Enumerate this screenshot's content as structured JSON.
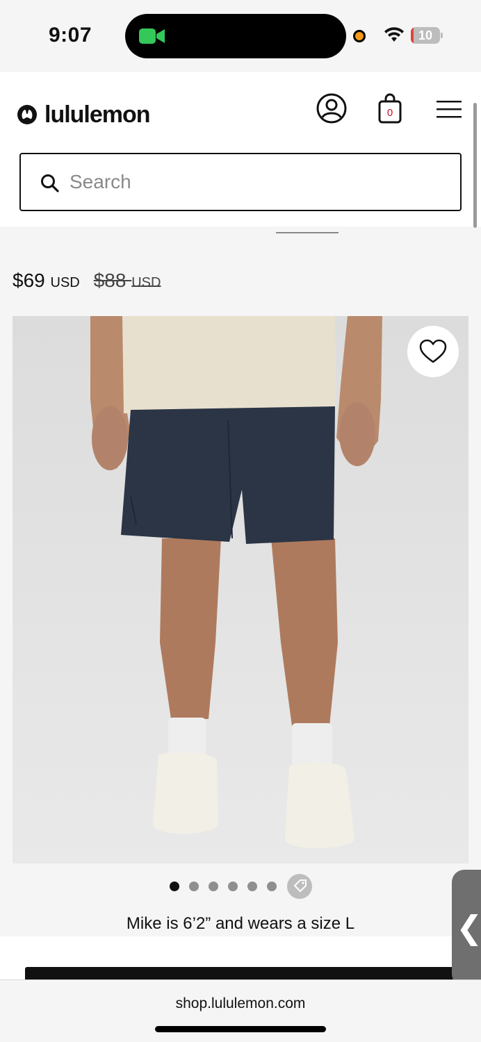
{
  "status_bar": {
    "time": "9:07",
    "battery": "10",
    "battery_level": 0.1,
    "icons": [
      "facetime-camera-icon",
      "mic-indicator-dot",
      "wifi-icon",
      "battery-icon"
    ]
  },
  "header": {
    "logo_text": "lululemon",
    "bag_count": "0",
    "icons": [
      "lululemon-logo-icon",
      "account-icon",
      "shopping-bag-icon",
      "menu-icon"
    ]
  },
  "search": {
    "placeholder": "Search",
    "value": ""
  },
  "product": {
    "price_current": "$69",
    "price_current_currency": "USD",
    "price_original": "$88",
    "price_original_currency": "USD",
    "image_alt": "Model wearing navy cargo shorts",
    "carousel_count": 6,
    "carousel_active": 1,
    "model_info": "Mike is 6’2” and wears a size L"
  },
  "browser": {
    "url": "shop.lululemon.com"
  },
  "colors": {
    "brand_red": "#c8102e",
    "text": "#111111",
    "page_bg": "#f5f5f5",
    "image_bg": "#e4e4e4",
    "shorts_navy": "#2b3545"
  }
}
